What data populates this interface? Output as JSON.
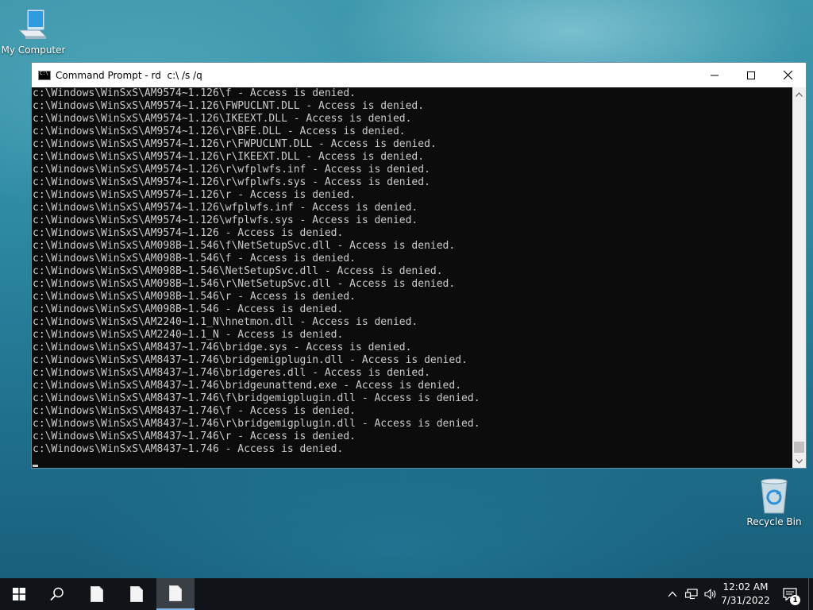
{
  "desktop": {
    "icons": [
      {
        "label": "My Computer",
        "icon": "computer-icon"
      },
      {
        "label": "Recycle Bin",
        "icon": "recycle-bin-icon"
      }
    ]
  },
  "window": {
    "title": "Command Prompt - rd  c:\\ /s /q",
    "icon": "console-icon",
    "controls": [
      "minimize",
      "maximize",
      "close"
    ]
  },
  "console": {
    "text_color": "#cccccc",
    "background": "#0c0c0c",
    "lines": [
      "c:\\Windows\\WinSxS\\AM9574~1.126\\f - Access is denied.",
      "c:\\Windows\\WinSxS\\AM9574~1.126\\FWPUCLNT.DLL - Access is denied.",
      "c:\\Windows\\WinSxS\\AM9574~1.126\\IKEEXT.DLL - Access is denied.",
      "c:\\Windows\\WinSxS\\AM9574~1.126\\r\\BFE.DLL - Access is denied.",
      "c:\\Windows\\WinSxS\\AM9574~1.126\\r\\FWPUCLNT.DLL - Access is denied.",
      "c:\\Windows\\WinSxS\\AM9574~1.126\\r\\IKEEXT.DLL - Access is denied.",
      "c:\\Windows\\WinSxS\\AM9574~1.126\\r\\wfplwfs.inf - Access is denied.",
      "c:\\Windows\\WinSxS\\AM9574~1.126\\r\\wfplwfs.sys - Access is denied.",
      "c:\\Windows\\WinSxS\\AM9574~1.126\\r - Access is denied.",
      "c:\\Windows\\WinSxS\\AM9574~1.126\\wfplwfs.inf - Access is denied.",
      "c:\\Windows\\WinSxS\\AM9574~1.126\\wfplwfs.sys - Access is denied.",
      "c:\\Windows\\WinSxS\\AM9574~1.126 - Access is denied.",
      "c:\\Windows\\WinSxS\\AM098B~1.546\\f\\NetSetupSvc.dll - Access is denied.",
      "c:\\Windows\\WinSxS\\AM098B~1.546\\f - Access is denied.",
      "c:\\Windows\\WinSxS\\AM098B~1.546\\NetSetupSvc.dll - Access is denied.",
      "c:\\Windows\\WinSxS\\AM098B~1.546\\r\\NetSetupSvc.dll - Access is denied.",
      "c:\\Windows\\WinSxS\\AM098B~1.546\\r - Access is denied.",
      "c:\\Windows\\WinSxS\\AM098B~1.546 - Access is denied.",
      "c:\\Windows\\WinSxS\\AM2240~1.1_N\\hnetmon.dll - Access is denied.",
      "c:\\Windows\\WinSxS\\AM2240~1.1_N - Access is denied.",
      "c:\\Windows\\WinSxS\\AM8437~1.746\\bridge.sys - Access is denied.",
      "c:\\Windows\\WinSxS\\AM8437~1.746\\bridgemigplugin.dll - Access is denied.",
      "c:\\Windows\\WinSxS\\AM8437~1.746\\bridgeres.dll - Access is denied.",
      "c:\\Windows\\WinSxS\\AM8437~1.746\\bridgeunattend.exe - Access is denied.",
      "c:\\Windows\\WinSxS\\AM8437~1.746\\f\\bridgemigplugin.dll - Access is denied.",
      "c:\\Windows\\WinSxS\\AM8437~1.746\\f - Access is denied.",
      "c:\\Windows\\WinSxS\\AM8437~1.746\\r\\bridgemigplugin.dll - Access is denied.",
      "c:\\Windows\\WinSxS\\AM8437~1.746\\r - Access is denied.",
      "c:\\Windows\\WinSxS\\AM8437~1.746 - Access is denied."
    ]
  },
  "taskbar": {
    "buttons": [
      "start-icon",
      "search-icon",
      "document-icon",
      "document-icon",
      "document-icon"
    ],
    "tray": [
      "chevron-up-icon",
      "network-icon",
      "volume-icon"
    ],
    "clock": {
      "time": "12:02 AM",
      "date": "7/31/2022"
    },
    "notifications_count": "1"
  }
}
